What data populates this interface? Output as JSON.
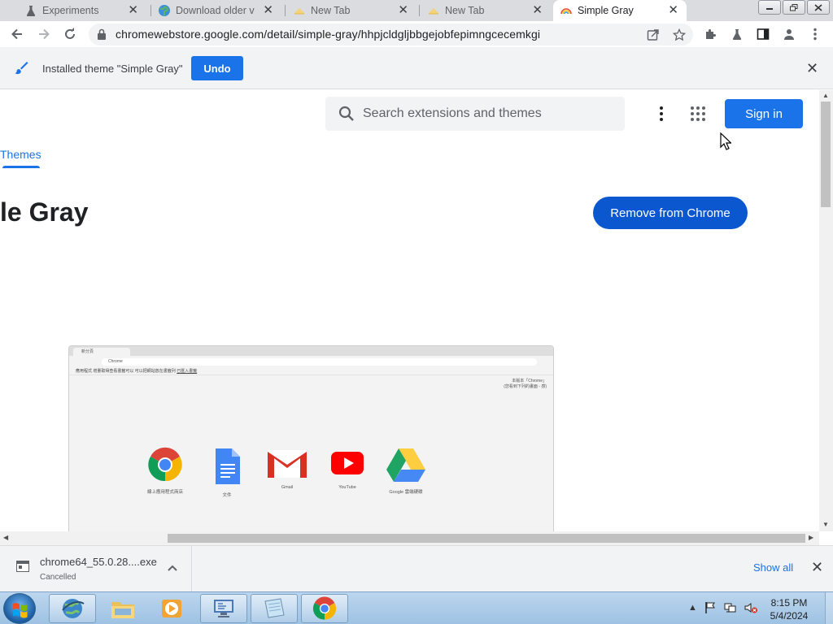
{
  "tabs": [
    {
      "title": "Experiments",
      "icon": "flask-icon",
      "active": false
    },
    {
      "title": "Download older v",
      "icon": "globe-icon",
      "active": false
    },
    {
      "title": "New Tab",
      "icon": "new-tab-icon",
      "active": false
    },
    {
      "title": "New Tab",
      "icon": "new-tab-icon",
      "active": false
    },
    {
      "title": "Simple Gray",
      "icon": "rainbow-icon",
      "active": true
    }
  ],
  "tab_close_glyph": "✕",
  "toolbar": {
    "url": "chromewebstore.google.com/detail/simple-gray/hhpjcldgljbbgejobfepimngcecemkgi"
  },
  "infobar": {
    "message": "Installed theme \"Simple Gray\"",
    "undo_label": "Undo",
    "close_glyph": "✕"
  },
  "page": {
    "search_placeholder": "Search extensions and themes",
    "signin_label": "Sign in",
    "themes_tab": "Themes",
    "title": "le Gray",
    "remove_label": "Remove from Chrome",
    "preview": {
      "tab_title": "新分頁",
      "omnibox_text": "Chrome",
      "bookmarks": "應用程式   增量取得查看書籤可以   可以把網站放在書籤列   ",
      "bookmarks_link": "已匯入書籤",
      "corner_line1": "本版本「Chrome」",
      "corner_line2": "(您看到下列的畫面 - 感)",
      "shortcuts": [
        {
          "label": "線上應用程式商店",
          "icon": "chrome-icon"
        },
        {
          "label": "文件",
          "icon": "docs-icon"
        },
        {
          "label": "Gmail",
          "icon": "gmail-icon"
        },
        {
          "label": "YouTube",
          "icon": "youtube-icon"
        },
        {
          "label": "Google 雲端硬碟",
          "icon": "drive-icon"
        }
      ]
    }
  },
  "downloads": {
    "filename": "chrome64_55.0.28....exe",
    "status": "Cancelled",
    "show_all": "Show all",
    "close_glyph": "✕"
  },
  "taskbar": {
    "time": "8:15 PM",
    "date": "5/4/2024"
  },
  "colors": {
    "accent": "#1a73e8",
    "remove_button": "#0b57d0",
    "tabstrip": "#dadce0"
  }
}
